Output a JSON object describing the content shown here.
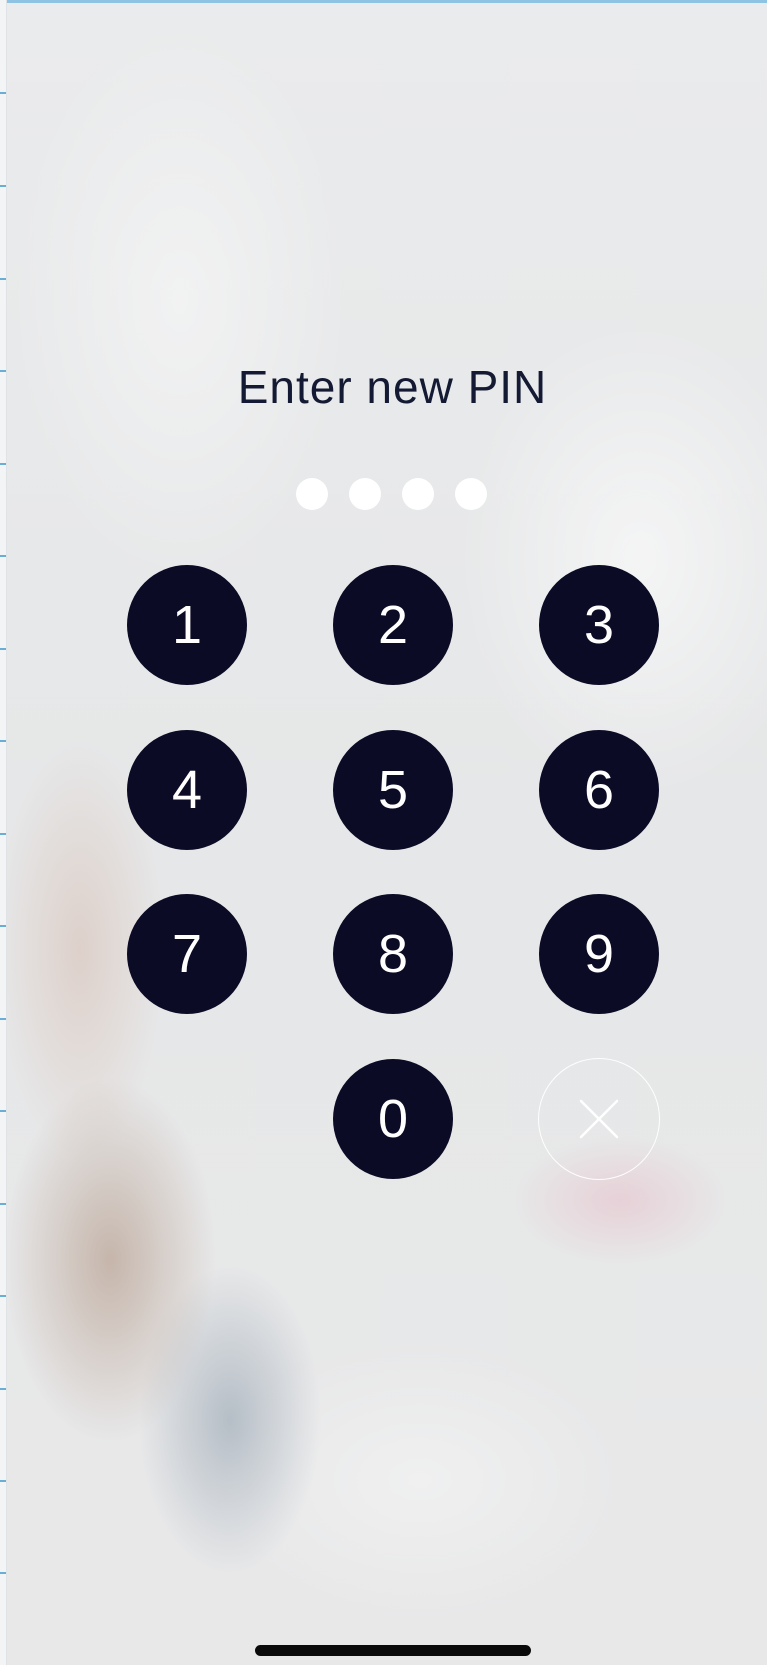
{
  "screen": {
    "title": "Enter new PIN",
    "pin_length": 4,
    "pin_entered": 0
  },
  "keypad": {
    "keys": [
      "1",
      "2",
      "3",
      "4",
      "5",
      "6",
      "7",
      "8",
      "9",
      "0"
    ],
    "delete_icon": "close-icon"
  },
  "colors": {
    "key_fill": "#0b0b26",
    "key_text": "#ffffff",
    "title_text": "#141a33",
    "dot_fill": "#ffffff"
  }
}
